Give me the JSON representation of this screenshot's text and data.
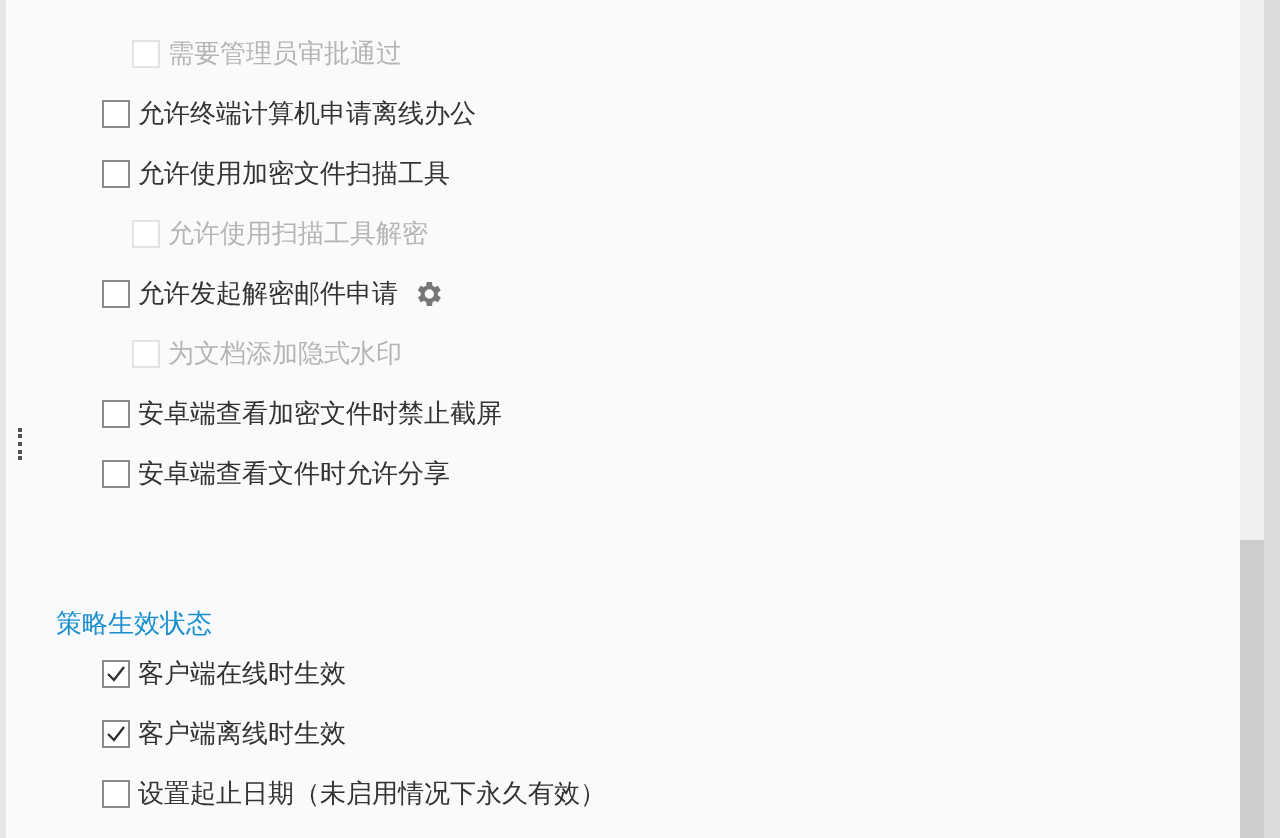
{
  "options": [
    {
      "label": "需要管理员审批通过",
      "kind": "sub-option",
      "checked": false,
      "disabled": true,
      "has_settings": false
    },
    {
      "label": "允许终端计算机申请离线办公",
      "kind": "option",
      "checked": false,
      "disabled": false,
      "has_settings": false
    },
    {
      "label": "允许使用加密文件扫描工具",
      "kind": "option",
      "checked": false,
      "disabled": false,
      "has_settings": false
    },
    {
      "label": "允许使用扫描工具解密",
      "kind": "sub-option",
      "checked": false,
      "disabled": true,
      "has_settings": false
    },
    {
      "label": "允许发起解密邮件申请",
      "kind": "option",
      "checked": false,
      "disabled": false,
      "has_settings": true
    },
    {
      "label": "为文档添加隐式水印",
      "kind": "sub-option",
      "checked": false,
      "disabled": true,
      "has_settings": false
    },
    {
      "label": "安卓端查看加密文件时禁止截屏",
      "kind": "option",
      "checked": false,
      "disabled": false,
      "has_settings": false
    },
    {
      "label": "安卓端查看文件时允许分享",
      "kind": "option",
      "checked": false,
      "disabled": false,
      "has_settings": false
    }
  ],
  "effective_status": {
    "title": "策略生效状态",
    "options": [
      {
        "label": "客户端在线时生效",
        "checked": true
      },
      {
        "label": "客户端离线时生效",
        "checked": true
      },
      {
        "label": "设置起止日期（未启用情况下永久有效）",
        "checked": false
      }
    ]
  }
}
